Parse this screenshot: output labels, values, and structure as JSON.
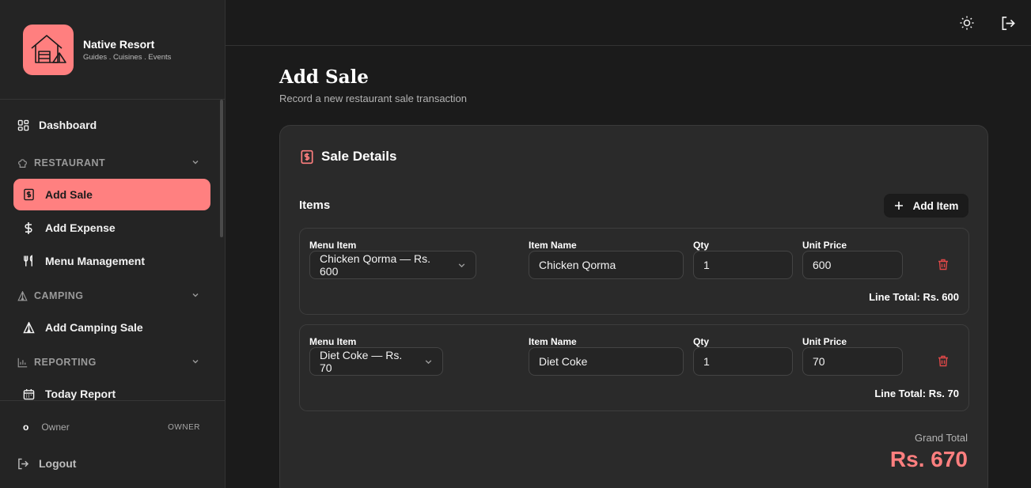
{
  "brand": {
    "name": "Native Resort",
    "tagline": "Guides . Cuisines . Events"
  },
  "sidebar": {
    "dashboard": "Dashboard",
    "sections": [
      {
        "label": "RESTAURANT",
        "items": [
          "Add Sale",
          "Add Expense",
          "Menu Management"
        ]
      },
      {
        "label": "CAMPING",
        "items": [
          "Add Camping Sale"
        ]
      },
      {
        "label": "REPORTING",
        "items": [
          "Today Report"
        ]
      }
    ],
    "active_item": "Add Sale",
    "active_color": "#ff8080"
  },
  "user": {
    "initial": "o",
    "name": "Owner",
    "role": "OWNER"
  },
  "logout_label": "Logout",
  "topbar": {
    "icons": [
      "sun-icon",
      "logout-icon"
    ]
  },
  "page": {
    "title": "Add Sale",
    "subtitle": "Record a new restaurant sale transaction"
  },
  "card": {
    "title": "Sale Details",
    "items_label": "Items",
    "add_item_label": "Add Item",
    "field_labels": {
      "menu_item": "Menu Item",
      "item_name": "Item Name",
      "qty": "Qty",
      "unit_price": "Unit Price"
    },
    "lines": [
      {
        "menu_item": "Chicken Qorma — Rs. 600",
        "item_name": "Chicken Qorma",
        "qty": "1",
        "unit_price": "600",
        "line_total": "Line Total: Rs. 600"
      },
      {
        "menu_item": "Diet Coke — Rs. 70",
        "item_name": "Diet Coke",
        "qty": "1",
        "unit_price": "70",
        "line_total": "Line Total: Rs. 70"
      }
    ],
    "grand_total_label": "Grand Total",
    "grand_total_value": "Rs. 670"
  },
  "colors": {
    "accent": "#ff7f7f",
    "danger": "#e04848",
    "background": "#1b1b1b",
    "card": "#2a2a2a"
  }
}
